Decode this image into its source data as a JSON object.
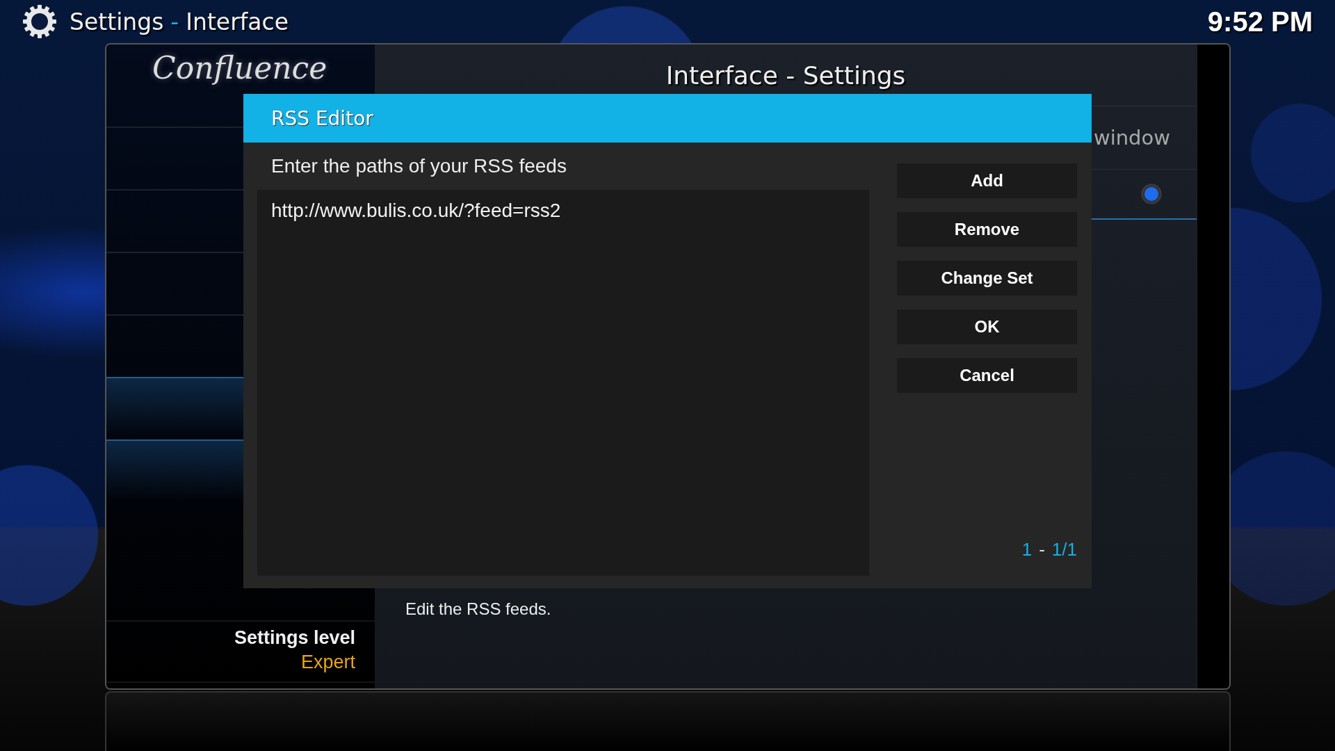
{
  "header": {
    "section": "Settings",
    "separator": "-",
    "page": "Interface",
    "clock": "9:52 PM"
  },
  "panel": {
    "logo": "Confluence",
    "title": "Interface - Settings",
    "partial_setting": "window",
    "radio_on": true,
    "description": "Edit the RSS feeds.",
    "settings_level": {
      "label": "Settings level",
      "value": "Expert"
    }
  },
  "dialog": {
    "title": "RSS Editor",
    "prompt": "Enter the paths of your RSS feeds",
    "feeds": [
      {
        "url": "http://www.bulis.co.uk/?feed=rss2"
      }
    ],
    "buttons": [
      "Add",
      "Remove",
      "Change Set",
      "OK",
      "Cancel"
    ],
    "page": {
      "current": "1",
      "separator": "-",
      "total": "1/1"
    }
  }
}
